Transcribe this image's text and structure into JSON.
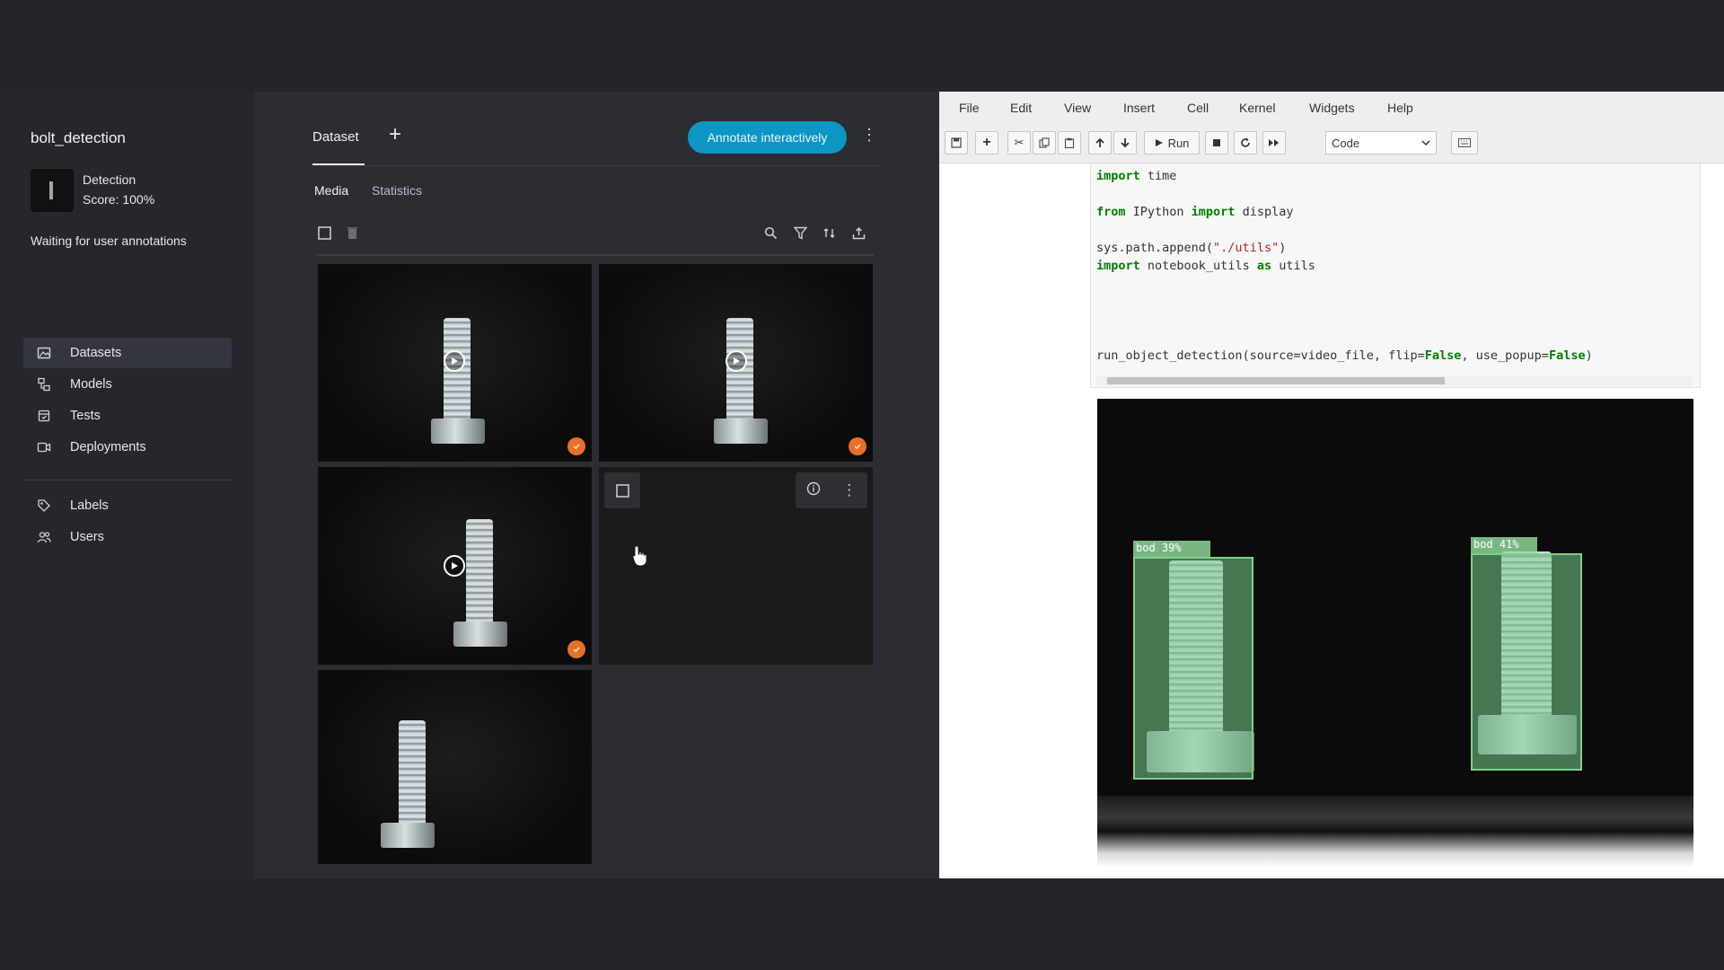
{
  "project": {
    "name": "bolt_detection",
    "task": "Detection",
    "score": "Score: 100%",
    "status": "Waiting for user annotations"
  },
  "sidebar": {
    "items": [
      {
        "label": "Datasets",
        "icon": "image-icon",
        "active": true
      },
      {
        "label": "Models",
        "icon": "models-icon",
        "active": false
      },
      {
        "label": "Tests",
        "icon": "tests-icon",
        "active": false
      },
      {
        "label": "Deployments",
        "icon": "deployments-icon",
        "active": false
      },
      {
        "label": "Labels",
        "icon": "labels-icon",
        "active": false
      },
      {
        "label": "Users",
        "icon": "users-icon",
        "active": false
      }
    ]
  },
  "main": {
    "tab": "Dataset",
    "add_tab": "+",
    "annotate_button": "Annotate interactively",
    "subtabs": [
      "Media",
      "Statistics"
    ]
  },
  "colors": {
    "accent": "#0d95c4",
    "badge": "#e8702a",
    "detection": "#7ed08a"
  },
  "jupyter": {
    "menu": [
      "File",
      "Edit",
      "View",
      "Insert",
      "Cell",
      "Kernel",
      "Widgets",
      "Help"
    ],
    "run_label": "Run",
    "cell_type": "Code",
    "code": {
      "l1_kw": "import",
      "l1_rest": " time",
      "l2_kw1": "from",
      "l2_mid": " IPython ",
      "l2_kw2": "import",
      "l2_rest": " display",
      "l3_pre": "sys.path.append(",
      "l3_str": "\"./utils\"",
      "l3_post": ")",
      "l4_kw1": "import",
      "l4_mid": " notebook_utils ",
      "l4_kw2": "as",
      "l4_rest": " utils",
      "l5_pre": "run_object_detection(source=video_file, flip=",
      "l5_b1": "False",
      "l5_mid": ", use_popup=",
      "l5_b2": "False",
      "l5_post": ")"
    },
    "detections": [
      {
        "label": "bod 39%"
      },
      {
        "label": "bod 41%"
      }
    ]
  }
}
